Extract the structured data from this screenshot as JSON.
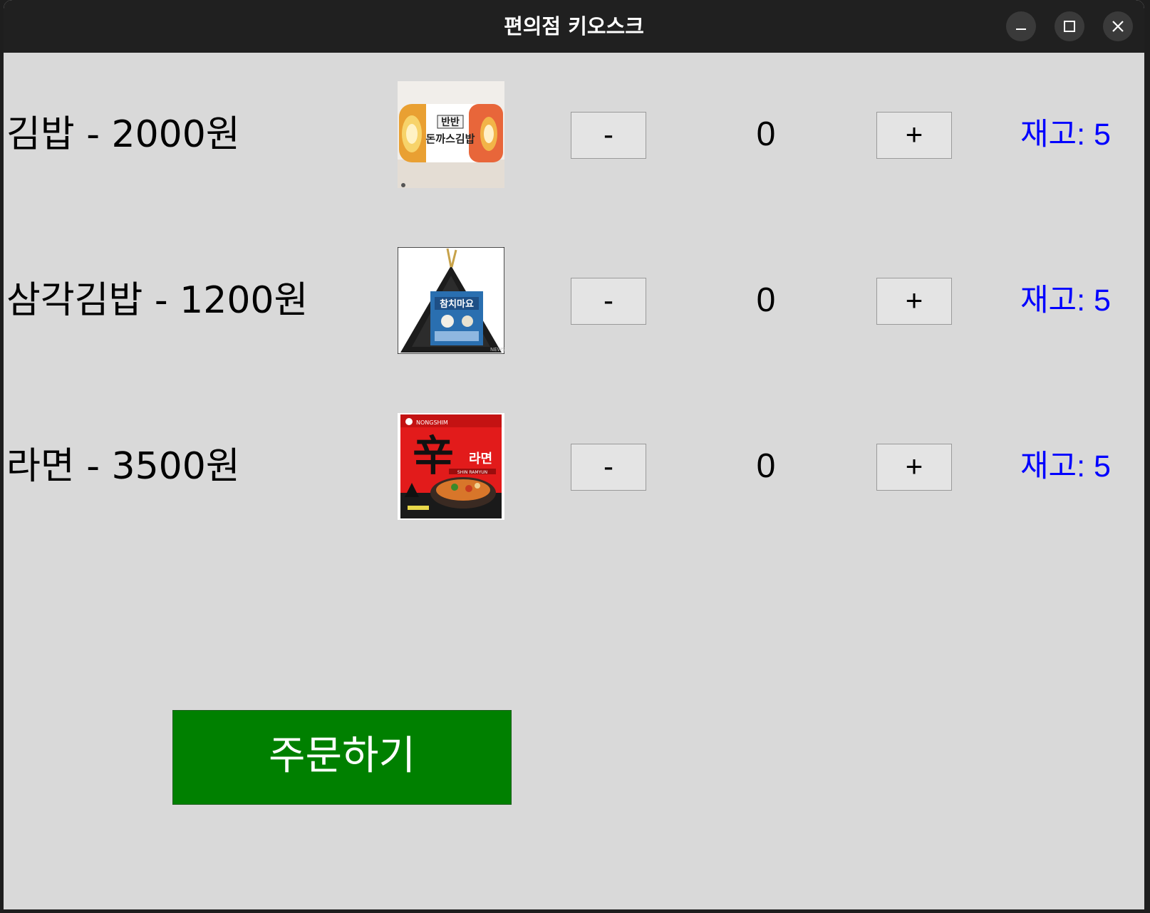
{
  "window": {
    "title": "편의점 키오스크",
    "controls": [
      "minimize-icon",
      "maximize-icon",
      "close-icon"
    ]
  },
  "products": [
    {
      "name_price": "김밥 - 2000원",
      "name": "김밥",
      "price": 2000,
      "image": "gimbap-package-image",
      "image_text": "반반 돈까스김밥",
      "minus_label": "-",
      "quantity": "0",
      "plus_label": "+",
      "stock_label": "재고: 5"
    },
    {
      "name_price": "삼각김밥 - 1200원",
      "name": "삼각김밥",
      "price": 1200,
      "image": "triangle-gimbap-image",
      "image_text": "참치마요",
      "minus_label": "-",
      "quantity": "0",
      "plus_label": "+",
      "stock_label": "재고: 5"
    },
    {
      "name_price": "라면 - 3500원",
      "name": "라면",
      "price": 3500,
      "image": "ramen-package-image",
      "image_text": "辛라면",
      "minus_label": "-",
      "quantity": "0",
      "plus_label": "+",
      "stock_label": "재고: 5"
    }
  ],
  "order_button": {
    "label": "주문하기",
    "color": "#008000"
  },
  "colors": {
    "background": "#d9d9d9",
    "titlebar": "#202020",
    "stock_text": "#0000ff"
  }
}
